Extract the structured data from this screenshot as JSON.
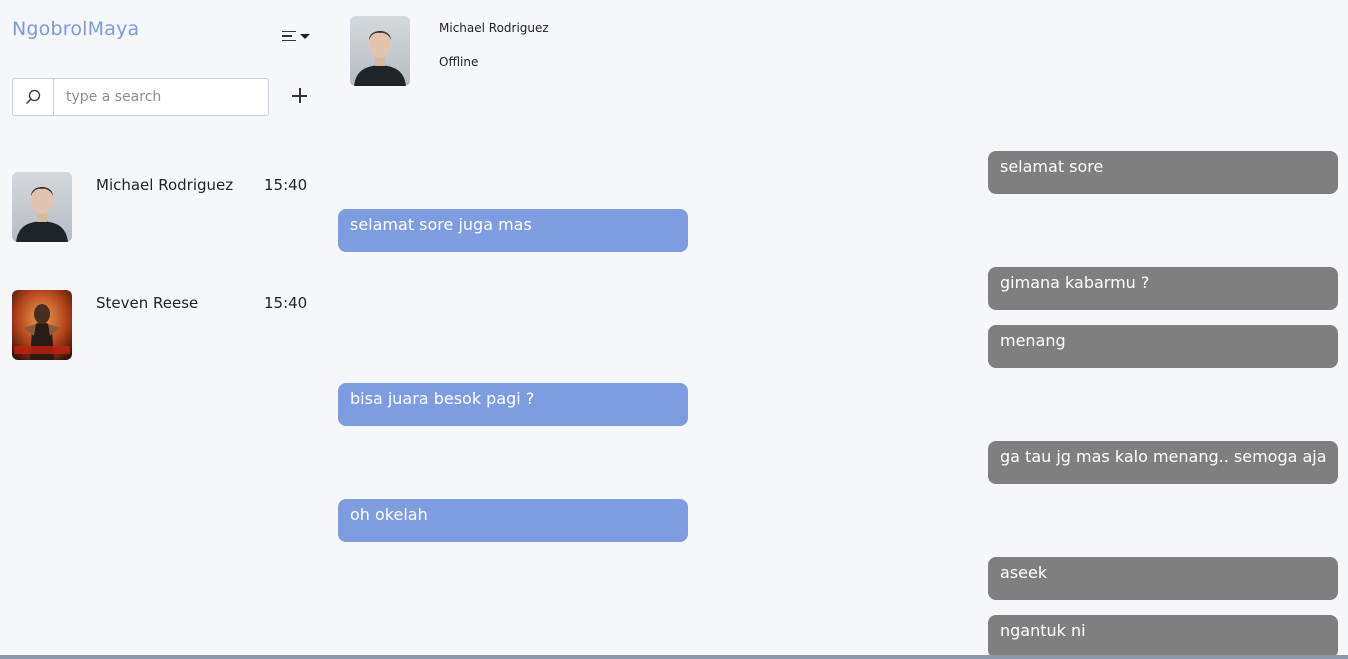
{
  "app": {
    "title": "NgobrolMaya"
  },
  "sidebar": {
    "menu_icon": "menu-lines-icon",
    "search": {
      "placeholder": "type a search",
      "value": "",
      "icon": "search-icon"
    },
    "add_icon": "plus-icon",
    "contacts": [
      {
        "name": "Michael Rodriguez",
        "time": "15:40",
        "avatar": "man-portrait"
      },
      {
        "name": "Steven Reese",
        "time": "15:40",
        "avatar": "game-character"
      }
    ]
  },
  "chat": {
    "header": {
      "name": "Michael Rodriguez",
      "status": "Offline"
    },
    "messages": [
      {
        "direction": "out",
        "text": "selamat sore"
      },
      {
        "direction": "in",
        "text": "selamat sore juga mas"
      },
      {
        "direction": "out",
        "text": "gimana kabarmu ?"
      },
      {
        "direction": "out",
        "text": "menang"
      },
      {
        "direction": "in",
        "text": "bisa juara besok pagi ?"
      },
      {
        "direction": "out",
        "text": "ga tau jg mas kalo menang.. semoga aja"
      },
      {
        "direction": "in",
        "text": "oh okelah"
      },
      {
        "direction": "out",
        "text": "aseek"
      },
      {
        "direction": "out",
        "text": "ngantuk ni"
      }
    ]
  },
  "colors": {
    "brand": "#7b9ad8",
    "outgoing_bubble": "#7f7f7f",
    "incoming_bubble": "#7e9ce0",
    "background": "#f5f7fa"
  }
}
